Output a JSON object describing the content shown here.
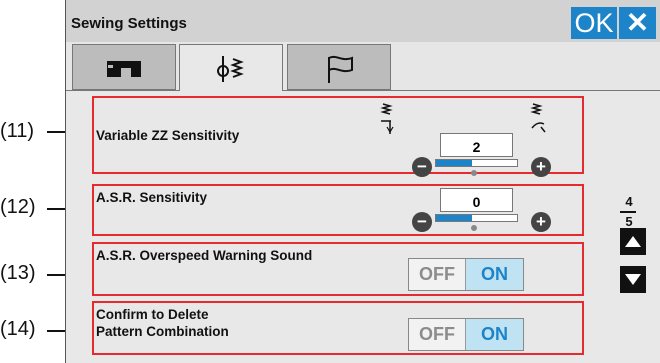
{
  "header": {
    "title": "Sewing Settings",
    "ok_label": "OK",
    "close_label": "✕"
  },
  "tabs": [
    {
      "name": "machine-settings",
      "icon": "sewing-machine-icon"
    },
    {
      "name": "sewing-settings",
      "icon": "stitch-icon",
      "active": true
    },
    {
      "name": "general-settings",
      "icon": "flag-icon"
    }
  ],
  "callouts": [
    "(11)",
    "(12)",
    "(13)",
    "(14)"
  ],
  "settings": {
    "variable_zz": {
      "label": "Variable ZZ Sensitivity",
      "value": "2",
      "level": 0.45
    },
    "asr_sensitivity": {
      "label": "A.S.R. Sensitivity",
      "value": "0",
      "level": 0.45
    },
    "asr_overspeed": {
      "label": "A.S.R. Overspeed Warning Sound",
      "off": "OFF",
      "on": "ON",
      "state": "ON"
    },
    "confirm_delete": {
      "label_line1": "Confirm to Delete",
      "label_line2": "Pattern Combination",
      "off": "OFF",
      "on": "ON",
      "state": "ON"
    }
  },
  "pagination": {
    "current": "4",
    "total": "5"
  },
  "colors": {
    "accent": "#1d84c9",
    "highlight": "#e52a30",
    "on_bg": "#bfe3f2"
  }
}
